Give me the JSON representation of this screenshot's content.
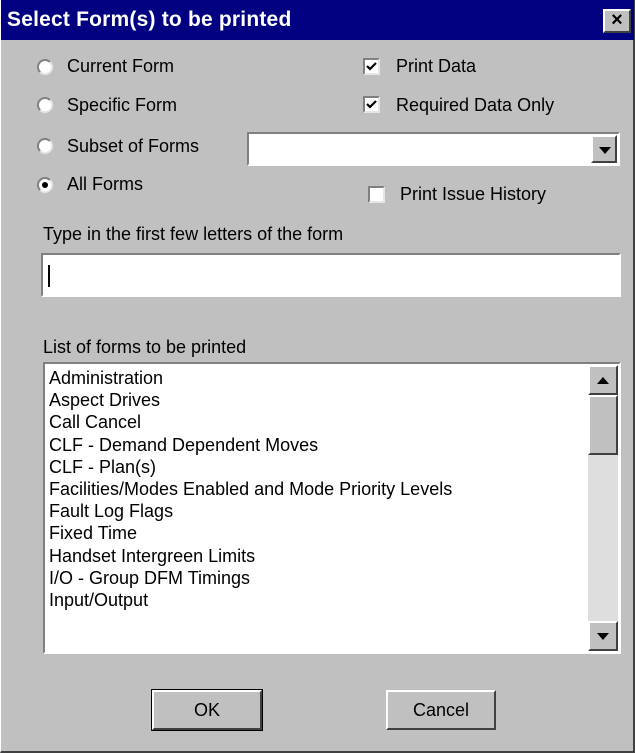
{
  "window": {
    "title": "Select Form(s) to be printed",
    "close_label": "×"
  },
  "radios": [
    {
      "label": "Current Form",
      "selected": false
    },
    {
      "label": "Specific Form",
      "selected": false
    },
    {
      "label": "Subset of Forms",
      "selected": false
    },
    {
      "label": "All Forms",
      "selected": true
    }
  ],
  "checkboxes": [
    {
      "label": "Print Data",
      "checked": true
    },
    {
      "label": "Required Data Only",
      "checked": true
    },
    {
      "label": "Print Issue History",
      "checked": false
    }
  ],
  "subset_combo": {
    "value": ""
  },
  "search": {
    "label": "Type in the first few letters of the form",
    "value": ""
  },
  "form_list": {
    "label": "List of forms to be printed",
    "items": [
      "Administration",
      "Aspect Drives",
      "Call Cancel",
      "CLF - Demand Dependent Moves",
      "CLF - Plan(s)",
      "Facilities/Modes Enabled and Mode Priority Levels",
      "Fault Log Flags",
      "Fixed Time",
      "Handset Intergreen Limits",
      "I/O - Group DFM Timings",
      "Input/Output"
    ]
  },
  "buttons": {
    "ok": "OK",
    "cancel": "Cancel"
  }
}
